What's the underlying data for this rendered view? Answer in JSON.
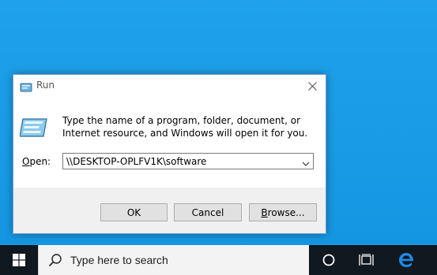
{
  "dialog": {
    "title": "Run",
    "description": "Type the name of a program, folder, document, or Internet resource, and Windows will open it for you.",
    "open_label_prefix": "",
    "open_label_access": "O",
    "open_label_rest": "pen:",
    "open_value": "\\\\DESKTOP-OPLFV1K\\software",
    "ok_label": "OK",
    "cancel_label": "Cancel",
    "browse_label_access": "B",
    "browse_label_rest": "rowse..."
  },
  "taskbar": {
    "search_placeholder": "Type here to search"
  },
  "icons": {
    "close": "close-icon",
    "run": "run-icon",
    "dropdown": "chevron-down-icon",
    "start": "windows-logo-icon",
    "search": "search-icon",
    "cortana": "cortana-circle-icon",
    "task_view": "task-view-icon",
    "edge": "edge-icon"
  },
  "colors": {
    "desktop": "#1a9be6",
    "taskbar": "#101820",
    "edge": "#1e88e5"
  }
}
